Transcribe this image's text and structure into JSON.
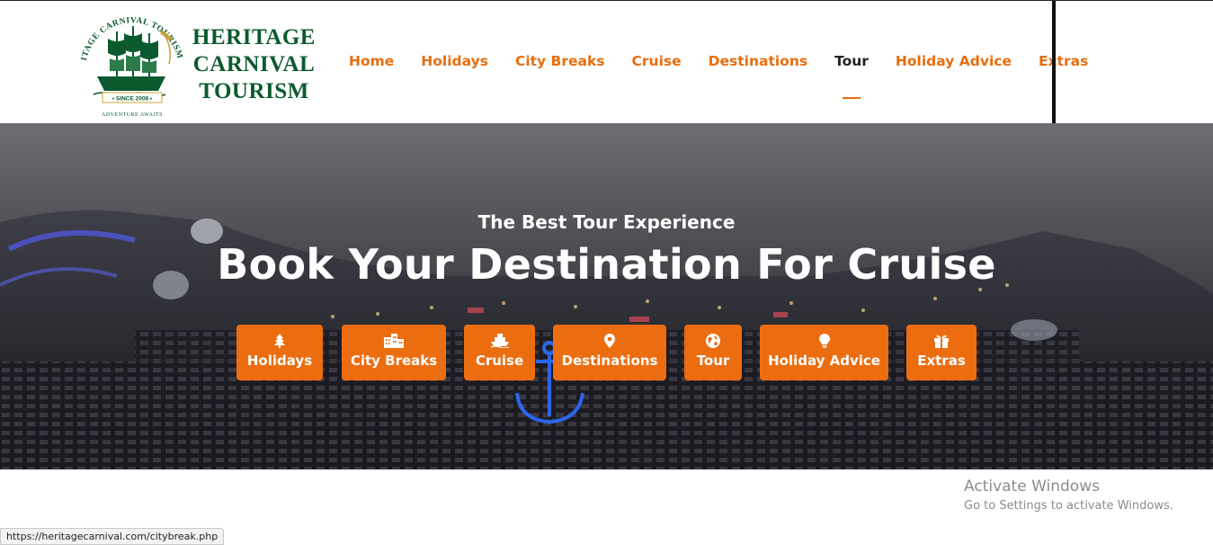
{
  "logo": {
    "line1": "HERITAGE",
    "line2": "CARNIVAL",
    "line3": "TOURISM",
    "emblem_arc": "HERITAGE CARNIVAL TOURISM LLC",
    "emblem_since": "• SINCE 2008 •",
    "emblem_motto": "ADVENTURE AWAITS"
  },
  "nav": {
    "items": [
      {
        "label": "Home"
      },
      {
        "label": "Holidays"
      },
      {
        "label": "City Breaks"
      },
      {
        "label": "Cruise"
      },
      {
        "label": "Destinations"
      },
      {
        "label": "Tour",
        "active": true
      },
      {
        "label": "Holiday Advice"
      },
      {
        "label": "Extras"
      }
    ]
  },
  "hero": {
    "subtitle": "The Best Tour Experience",
    "title": "Book Your Destination For Cruise",
    "buttons": [
      {
        "label": "Holidays",
        "icon": "tree-icon"
      },
      {
        "label": "City Breaks",
        "icon": "building-icon"
      },
      {
        "label": "Cruise",
        "icon": "ship-icon"
      },
      {
        "label": "Destinations",
        "icon": "map-pin-icon"
      },
      {
        "label": "Tour",
        "icon": "globe-icon"
      },
      {
        "label": "Holiday Advice",
        "icon": "lightbulb-icon"
      },
      {
        "label": "Extras",
        "icon": "gift-icon"
      }
    ]
  },
  "watermark": {
    "title": "Activate Windows",
    "subtitle": "Go to Settings to activate Windows."
  },
  "status_bar": {
    "url": "https://heritagecarnival.com/citybreak.php"
  },
  "colors": {
    "brand_orange": "#ec6d10",
    "logo_green": "#0b5a2e",
    "logo_gold": "#c9a43a",
    "active_nav": "#222222"
  }
}
